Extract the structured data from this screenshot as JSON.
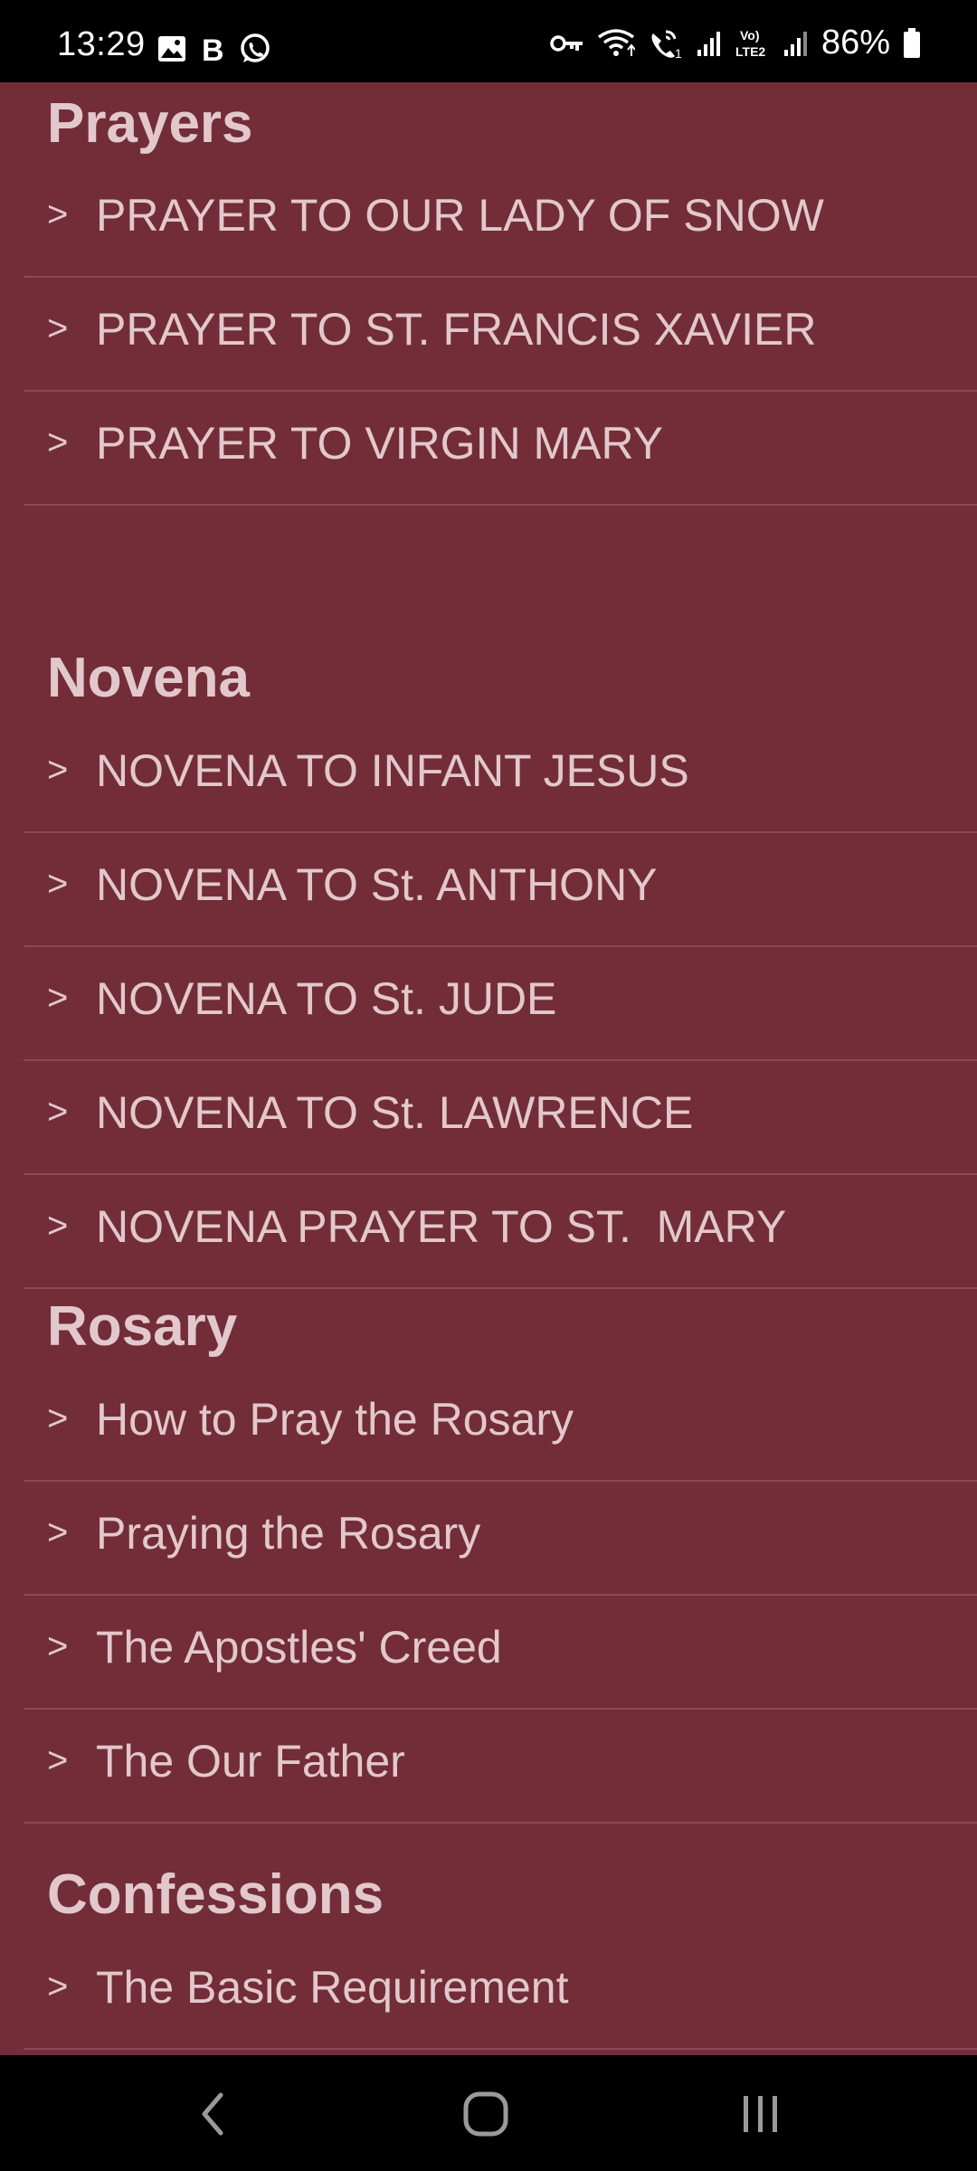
{
  "status_bar": {
    "time": "13:29",
    "left_icons": [
      "gallery-icon",
      "b-app-icon",
      "whatsapp-icon"
    ],
    "right_icons": [
      "vpn-key-icon",
      "wifi-icon",
      "wifi-call-icon",
      "signal-icon",
      "volte-icon",
      "signal-icon-2",
      "battery-icon"
    ],
    "volte_label": "Vo) LTE2",
    "battery": "86%"
  },
  "sections": [
    {
      "title": "Prayers",
      "items": [
        {
          "chevron": ">",
          "label": "PRAYER TO OUR LADY OF SNOW"
        },
        {
          "chevron": ">",
          "label": "PRAYER TO ST. FRANCIS XAVIER"
        },
        {
          "chevron": ">",
          "label": "PRAYER TO VIRGIN MARY"
        }
      ]
    },
    {
      "title": "Novena",
      "items": [
        {
          "chevron": ">",
          "label": "NOVENA TO INFANT JESUS"
        },
        {
          "chevron": ">",
          "label": "NOVENA TO St. ANTHONY"
        },
        {
          "chevron": ">",
          "label": "NOVENA TO St. JUDE"
        },
        {
          "chevron": ">",
          "label": "NOVENA TO St. LAWRENCE"
        },
        {
          "chevron": ">",
          "label": "NOVENA PRAYER TO ST.  MARY"
        }
      ]
    },
    {
      "title": "Rosary",
      "items": [
        {
          "chevron": ">",
          "label": "How to Pray the Rosary"
        },
        {
          "chevron": ">",
          "label": "Praying the Rosary"
        },
        {
          "chevron": ">",
          "label": "The Apostles' Creed"
        },
        {
          "chevron": ">",
          "label": "The Our Father"
        }
      ]
    },
    {
      "title": "Confessions",
      "items": [
        {
          "chevron": ">",
          "label": "The Basic Requirement"
        }
      ]
    }
  ],
  "nav_bar": {
    "buttons": [
      "back-icon",
      "home-icon",
      "recents-icon"
    ]
  },
  "colors": {
    "background": "#722D39",
    "text": "#E2C8CC",
    "divider": "#8A4A55",
    "system_bar": "#000000"
  }
}
